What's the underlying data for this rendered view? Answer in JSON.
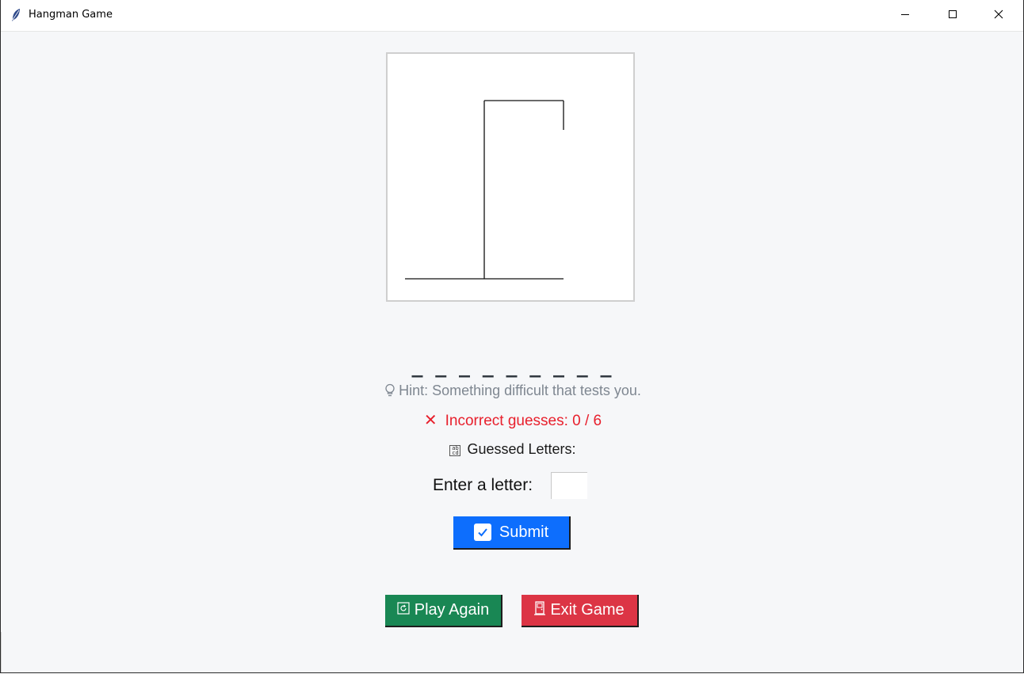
{
  "window": {
    "title": "Hangman Game",
    "icon": "feather-icon",
    "controls": [
      "minimize-icon",
      "maximize-icon",
      "close-icon"
    ]
  },
  "game": {
    "word_display": "_ _ _ _ _ _ _ _ _",
    "hint_icon": "lightbulb-icon",
    "hint": "Hint: Something difficult that tests you.",
    "incorrect_icon": "x-icon",
    "incorrect_text": "Incorrect guesses: 0 / 6",
    "incorrect_count": 0,
    "max_incorrect": 6,
    "guessed_icon": "letters-grid-icon",
    "guessed_label": "Guessed Letters:",
    "guessed_letters": "",
    "input_label": "Enter a letter:",
    "input_value": ""
  },
  "buttons": {
    "submit": {
      "label": "Submit",
      "icon": "checkbox-check-icon",
      "color": "#0d6efd"
    },
    "play_again": {
      "label": "Play Again",
      "icon": "refresh-icon",
      "color": "#198754"
    },
    "exit": {
      "label": "Exit Game",
      "icon": "door-icon",
      "color": "#dc3545"
    }
  },
  "colors": {
    "background": "#f6f7f9",
    "hint": "#7f8791",
    "incorrect": "#e8202d"
  }
}
